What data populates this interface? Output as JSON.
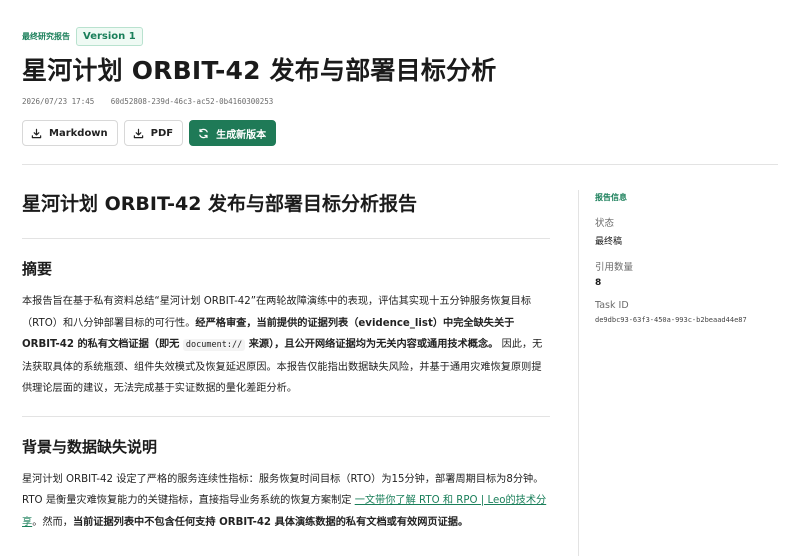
{
  "header": {
    "tag_label": "最终研究报告",
    "version": "Version 1",
    "title": "星河计划 ORBIT-42 发布与部署目标分析",
    "date": "2026/07/23 17:45",
    "id": "60d52808-239d-46c3-ac52-0b4160300253",
    "buttons": {
      "markdown": "Markdown",
      "pdf": "PDF",
      "regenerate": "生成新版本"
    }
  },
  "doc": {
    "title": "星河计划 ORBIT-42 发布与部署目标分析报告",
    "sections": [
      {
        "heading": "摘要",
        "p1": "本报告旨在基于私有资料总结“星河计划 ORBIT-42”在两轮故障演练中的表现，评估其实现十五分钟服务恢复目标（RTO）和八分钟部署目标的可行性。",
        "p1_bold_a": "经严格审查，当前提供的证据列表（evidence_list）中完全缺失关于 ORBIT-42 的私有文档证据（即无 ",
        "p1_code": "document://",
        "p1_bold_b": " 来源），且公开网络证据均为无关内容或通用技术概念。",
        "p1_tail": "因此，无法获取具体的系统瓶颈、组件失效模式及恢复延迟原因。本报告仅能指出数据缺失风险，并基于通用灾难恢复原则提供理论层面的建议，无法完成基于实证数据的量化差距分析。"
      },
      {
        "heading": "背景与数据缺失说明",
        "p1": "星河计划 ORBIT-42 设定了严格的服务连续性指标：服务恢复时间目标（RTO）为15分钟，部署周期目标为8分钟。RTO 是衡量灾难恢复能力的关键指标，直接指导业务系统的恢复方案制定 ",
        "p1_link": "一文带你了解 RTO 和 RPO | Leo的技术分享",
        "p1_mid": "。然而，",
        "p1_bold": "当前证据列表中不包含任何支持 ORBIT-42 具体演练数据的私有文档或有效网页证据。"
      }
    ]
  },
  "sidebar": {
    "heading": "报告信息",
    "status_label": "状态",
    "status_value": "最终稿",
    "citations_label": "引用数量",
    "citations_value": "8",
    "task_label": "Task ID",
    "task_value": "de9dbc93-63f3-450a-993c-b2beaad44e87"
  },
  "colors": {
    "accent": "#1f7a57",
    "accent_text": "#1a7f5a"
  },
  "icons": {
    "markdown": "download-icon",
    "pdf": "download-icon",
    "regenerate": "refresh-icon"
  }
}
